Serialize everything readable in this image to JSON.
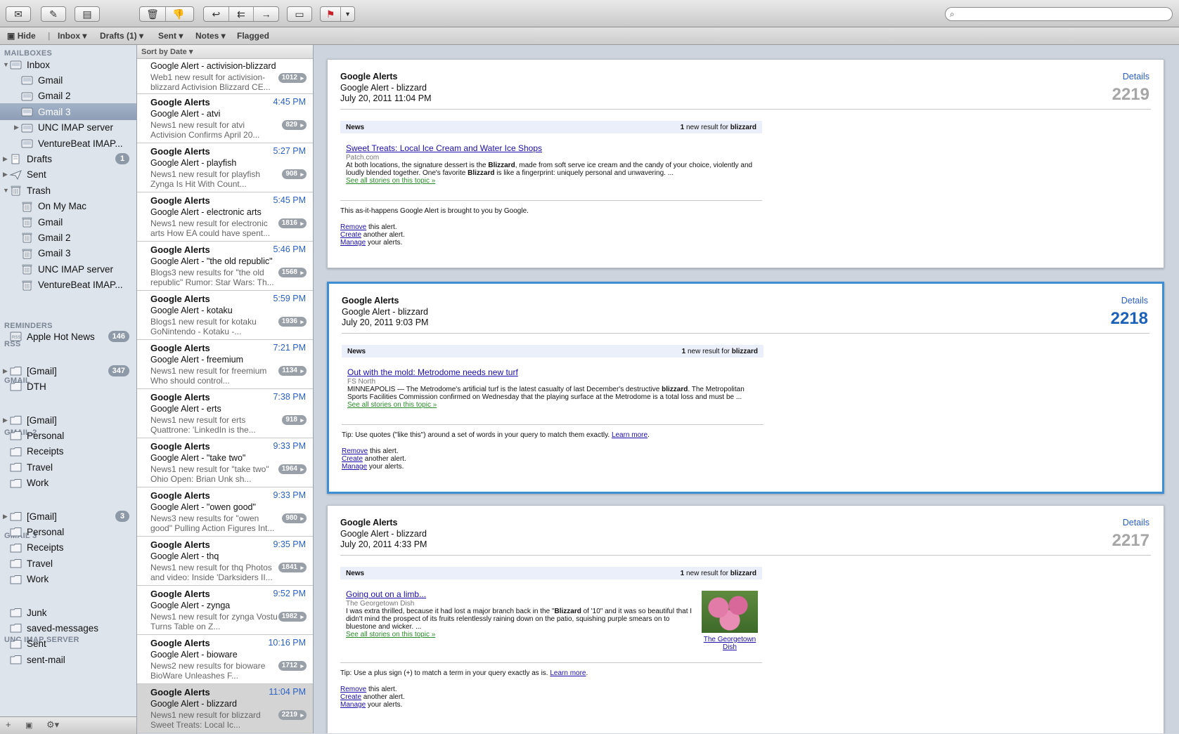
{
  "toolbar": {
    "buttons": [
      "get-mail-icon",
      "compose-icon",
      "note-icon",
      "delete-icon",
      "junk-icon",
      "reply-icon",
      "reply-all-icon",
      "forward-icon",
      "archive-icon",
      "flag-icon"
    ],
    "search_placeholder": ""
  },
  "favorites": {
    "hide": "Hide",
    "inbox": "Inbox",
    "drafts": "Drafts (1)",
    "sent": "Sent",
    "notes": "Notes",
    "flagged": "Flagged"
  },
  "sidebar": {
    "mailboxes_header": "MAILBOXES",
    "reminders_header": "REMINDERS",
    "rss_header": "RSS",
    "gmail_header": "GMAIL",
    "gmail2_header": "GMAIL 2",
    "gmail3_header": "GMAIL 3",
    "unc_header": "UNC IMAP SERVER",
    "mailboxes": [
      {
        "label": "Inbox"
      },
      {
        "label": "Gmail"
      },
      {
        "label": "Gmail 2"
      },
      {
        "label": "Gmail 3"
      },
      {
        "label": "UNC IMAP server"
      },
      {
        "label": "VentureBeat IMAP..."
      },
      {
        "label": "Drafts",
        "badge": "1"
      },
      {
        "label": "Sent"
      },
      {
        "label": "Trash"
      },
      {
        "label": "On My Mac"
      },
      {
        "label": "Gmail"
      },
      {
        "label": "Gmail 2"
      },
      {
        "label": "Gmail 3"
      },
      {
        "label": "UNC IMAP server"
      },
      {
        "label": "VentureBeat IMAP..."
      }
    ],
    "rss": [
      {
        "label": "Apple Hot News",
        "badge": "146"
      }
    ],
    "gmail": [
      {
        "label": "[Gmail]",
        "badge": "347"
      },
      {
        "label": "DTH"
      }
    ],
    "gmail2": [
      {
        "label": "[Gmail]"
      },
      {
        "label": "Personal"
      },
      {
        "label": "Receipts"
      },
      {
        "label": "Travel"
      },
      {
        "label": "Work"
      }
    ],
    "gmail3": [
      {
        "label": "[Gmail]",
        "badge": "3"
      },
      {
        "label": "Personal"
      },
      {
        "label": "Receipts"
      },
      {
        "label": "Travel"
      },
      {
        "label": "Work"
      }
    ],
    "unc": [
      {
        "label": "Junk"
      },
      {
        "label": "saved-messages"
      },
      {
        "label": "Sent"
      },
      {
        "label": "sent-mail"
      }
    ]
  },
  "message_list": {
    "sort_label": "Sort by Date ▾",
    "messages": [
      {
        "from": "",
        "time": "",
        "subject": "Google Alert - activision-blizzard",
        "preview": "Web1 new result for activision-blizzard Activision Blizzard CE...",
        "count": "1012"
      },
      {
        "from": "Google Alerts",
        "time": "4:45 PM",
        "subject": "Google Alert - atvi",
        "preview": "News1 new result for atvi Activision Confirms April 20...",
        "count": "829"
      },
      {
        "from": "Google Alerts",
        "time": "5:27 PM",
        "subject": "Google Alert - playfish",
        "preview": "News1 new result for playfish Zynga Is Hit With Count...",
        "count": "908"
      },
      {
        "from": "Google Alerts",
        "time": "5:45 PM",
        "subject": "Google Alert - electronic arts",
        "preview": "News1 new result for electronic arts How EA could have spent...",
        "count": "1816"
      },
      {
        "from": "Google Alerts",
        "time": "5:46 PM",
        "subject": "Google Alert - \"the old republic\"",
        "preview": "Blogs3 new results for \"the old republic\" Rumor: Star Wars: Th...",
        "count": "1568"
      },
      {
        "from": "Google Alerts",
        "time": "5:59 PM",
        "subject": "Google Alert - kotaku",
        "preview": "Blogs1 new result for kotaku GoNintendo - Kotaku -...",
        "count": "1936"
      },
      {
        "from": "Google Alerts",
        "time": "7:21 PM",
        "subject": "Google Alert - freemium",
        "preview": "News1 new result for freemium Who should control...",
        "count": "1134"
      },
      {
        "from": "Google Alerts",
        "time": "7:38 PM",
        "subject": "Google Alert - erts",
        "preview": "News1 new result for erts Quattrone: 'LinkedIn is the...",
        "count": "918"
      },
      {
        "from": "Google Alerts",
        "time": "9:33 PM",
        "subject": "Google Alert - \"take two\"",
        "preview": "News1 new result for \"take two\" Ohio Open: Brian Unk sh...",
        "count": "1964"
      },
      {
        "from": "Google Alerts",
        "time": "9:33 PM",
        "subject": "Google Alert - \"owen good\"",
        "preview": "News3 new results for \"owen good\" Pulling Action Figures Int...",
        "count": "980"
      },
      {
        "from": "Google Alerts",
        "time": "9:35 PM",
        "subject": "Google Alert - thq",
        "preview": "News1 new result for thq Photos and video: Inside 'Darksiders II...",
        "count": "1841"
      },
      {
        "from": "Google Alerts",
        "time": "9:52 PM",
        "subject": "Google Alert - zynga",
        "preview": "News1 new result for zynga Vostu Turns Table on Z...",
        "count": "1982"
      },
      {
        "from": "Google Alerts",
        "time": "10:16 PM",
        "subject": "Google Alert - bioware",
        "preview": "News2 new results for bioware BioWare Unleashes F...",
        "count": "1712"
      },
      {
        "from": "Google Alerts",
        "time": "11:04 PM",
        "subject": "Google Alert - blizzard",
        "preview": "News1 new result for blizzard Sweet Treats: Local Ic...",
        "count": "2219"
      }
    ]
  },
  "preview": {
    "cards": [
      {
        "from": "Google Alerts",
        "subject": "Google Alert - blizzard",
        "date": "July 20, 2011 11:04 PM",
        "details": "Details",
        "number": "2219",
        "news_label": "News",
        "result_pre": "1",
        "result_mid": "new result for",
        "result_term": "blizzard",
        "story_title": "Sweet Treats: Local Ice Cream and Water Ice Shops",
        "story_source": "Patch.com",
        "story_snippet": "At both locations, the signature dessert is the Blizzard, made from soft serve ice cream and the candy of your choice, violently and loudly blended together. One's favorite Blizzard is like a fingerprint: uniquely personal and unwavering. ...",
        "see_all": "See all stories on this topic »",
        "footer_text": "This as-it-happens Google Alert is brought to you by Google.",
        "learn_more": "",
        "remove": "Remove",
        "remove_rest": "this alert.",
        "create": "Create",
        "create_rest": "another alert.",
        "manage": "Manage",
        "manage_rest": "your alerts."
      },
      {
        "from": "Google Alerts",
        "subject": "Google Alert - blizzard",
        "date": "July 20, 2011 9:03 PM",
        "details": "Details",
        "number": "2218",
        "news_label": "News",
        "result_pre": "1",
        "result_mid": "new result for",
        "result_term": "blizzard",
        "story_title": "Out with the mold: Metrodome needs new turf",
        "story_source": "FS North",
        "story_snippet": "MINNEAPOLIS — The Metrodome's artificial turf is the latest casualty of last December's destructive blizzard. The Metropolitan Sports Facilities Commission confirmed on Wednesday that the playing surface at the Metrodome is a total loss and must be ...",
        "see_all": "See all stories on this topic »",
        "footer_text": "Tip: Use quotes (\"like this\") around a set of words in your query to match them exactly.",
        "learn_more": "Learn more",
        "remove": "Remove",
        "remove_rest": "this alert.",
        "create": "Create",
        "create_rest": "another alert.",
        "manage": "Manage",
        "manage_rest": "your alerts."
      },
      {
        "from": "Google Alerts",
        "subject": "Google Alert - blizzard",
        "date": "July 20, 2011 4:33 PM",
        "details": "Details",
        "number": "2217",
        "news_label": "News",
        "result_pre": "1",
        "result_mid": "new result for",
        "result_term": "blizzard",
        "story_title": "Going out on a limb...",
        "story_source": "The Georgetown Dish",
        "story_snippet": "I was extra thrilled, because it had lost a major branch back in the \"Blizzard of '10\" and it was so beautiful that I didn't mind the prospect of its fruits relentlessly raining down on the patio, squishing purple smears on to bluestone and wicker. ...",
        "see_all": "See all stories on this topic »",
        "image_caption": "The Georgetown Dish",
        "footer_text": "Tip: Use a plus sign (+) to match a term in your query exactly as is.",
        "learn_more": "Learn more",
        "remove": "Remove",
        "remove_rest": "this alert.",
        "create": "Create",
        "create_rest": "another alert.",
        "manage": "Manage",
        "manage_rest": "your alerts."
      }
    ]
  }
}
